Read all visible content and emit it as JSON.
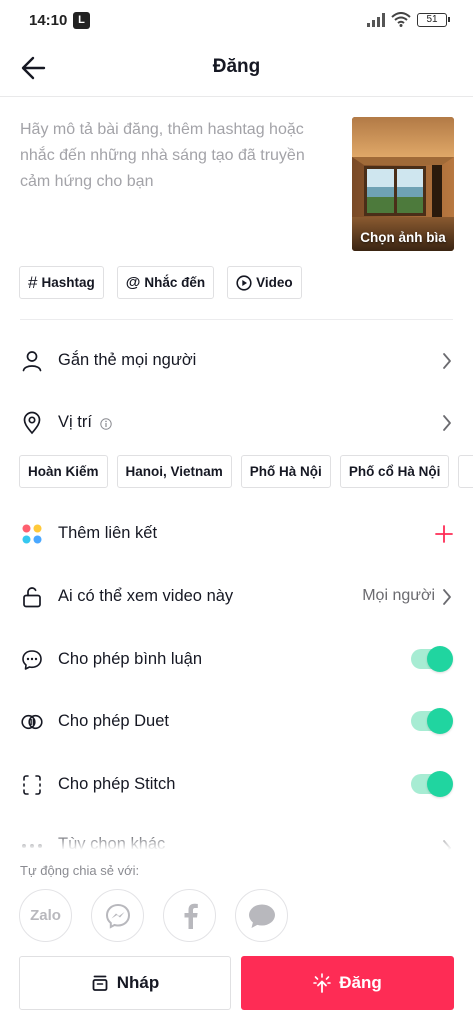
{
  "status": {
    "time": "14:10",
    "app_badge": "L",
    "battery": "51"
  },
  "header": {
    "title": "Đăng"
  },
  "description": {
    "placeholder": "Hãy mô tả bài đăng, thêm hashtag hoặc nhắc đến những nhà sáng tạo đã truyền cảm hứng cho bạn"
  },
  "cover": {
    "label": "Chọn ảnh bìa"
  },
  "chips": [
    {
      "icon": "#",
      "label": "Hashtag"
    },
    {
      "icon": "@",
      "label": "Nhắc đến"
    },
    {
      "icon": "▶",
      "label": "Video"
    }
  ],
  "tag_people": {
    "label": "Gắn thẻ mọi người"
  },
  "location": {
    "label": "Vị trí",
    "suggestions": [
      "Hoàn Kiếm",
      "Hanoi, Vietnam",
      "Phố Hà Nội",
      "Phố cổ Hà Nội"
    ]
  },
  "add_link": {
    "label": "Thêm liên kết"
  },
  "privacy": {
    "label": "Ai có thể xem video này",
    "value": "Mọi người"
  },
  "allow_comments": {
    "label": "Cho phép bình luận",
    "on": true
  },
  "allow_duet": {
    "label": "Cho phép Duet",
    "on": true
  },
  "allow_stitch": {
    "label": "Cho phép Stitch",
    "on": true
  },
  "more_options": {
    "label": "Tùy chọn khác"
  },
  "share": {
    "label": "Tự động chia sẻ với:",
    "targets": [
      "Zalo",
      "Messenger",
      "Facebook",
      "Message"
    ]
  },
  "actions": {
    "draft_label": "Nháp",
    "post_label": "Đăng"
  },
  "colors": {
    "accent": "#fe2c55",
    "toggle_on": "#20d5a0"
  }
}
